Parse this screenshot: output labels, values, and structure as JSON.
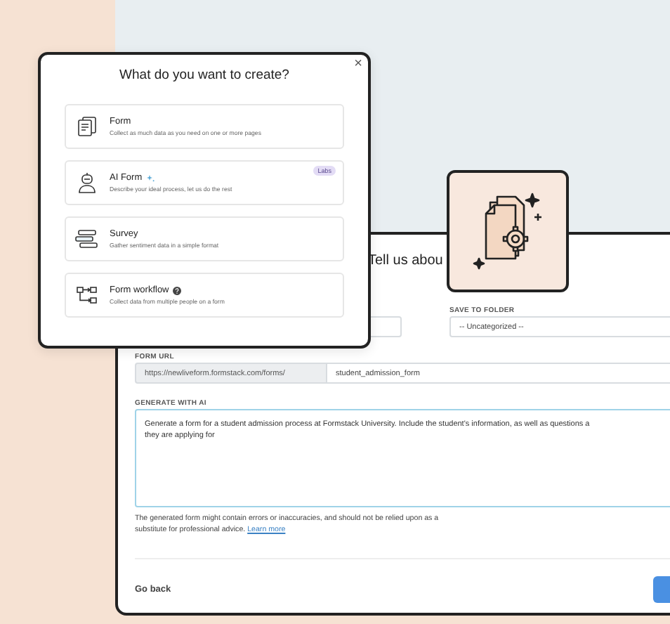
{
  "form_panel": {
    "heading": "Tell us abou",
    "folder": {
      "label": "SAVE TO FOLDER",
      "value": "-- Uncategorized --"
    },
    "url": {
      "label": "FORM URL",
      "prefix": "https://newliveform.formstack.com/forms/",
      "value": "student_admission_form"
    },
    "generate": {
      "label": "GENERATE WITH AI",
      "lines": [
        "Generate a form for a student admission process at Formstack University. Include the student's information, as well as questions a",
        "they are applying for"
      ]
    },
    "disclaimer": "The generated form might contain errors or inaccuracies, and should not be relied upon as a substitute for professional advice.",
    "learn_more": "Learn more",
    "back": "Go back"
  },
  "create_dialog": {
    "close": "×",
    "title": "What do you want to create?",
    "options": [
      {
        "kind": "form",
        "title": "Form",
        "description": "Collect as much data as you need on one or more pages"
      },
      {
        "kind": "ai",
        "title": "AI Form",
        "description": "Describe your ideal process, let us do the rest",
        "badge": "Labs"
      },
      {
        "kind": "survey",
        "title": "Survey",
        "description": "Gather sentiment data in a simple format"
      },
      {
        "kind": "workflow",
        "title": "Form workflow",
        "description": "Collect data from multiple people on a form"
      }
    ]
  }
}
